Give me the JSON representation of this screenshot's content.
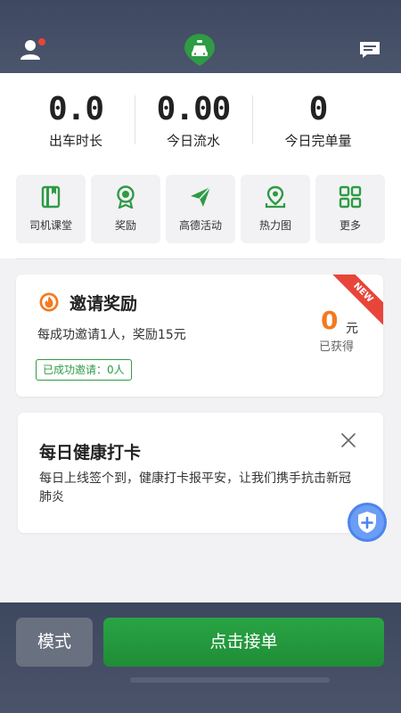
{
  "header": {
    "icons": [
      "user-icon",
      "taxi-logo-icon",
      "message-icon"
    ],
    "colors": {
      "notification_dot": "#e8453a",
      "logo_green": "#2e9b45"
    }
  },
  "stats": [
    {
      "value": "0.0",
      "label": "出车时长"
    },
    {
      "value": "0.00",
      "label": "今日流水"
    },
    {
      "value": "0",
      "label": "今日完单量"
    }
  ],
  "tiles": [
    {
      "label": "司机课堂",
      "icon": "book-icon"
    },
    {
      "label": "奖励",
      "icon": "medal-icon"
    },
    {
      "label": "高德活动",
      "icon": "paper-plane-icon"
    },
    {
      "label": "热力图",
      "icon": "map-pin-icon"
    },
    {
      "label": "更多",
      "icon": "grid-icon"
    }
  ],
  "invite": {
    "title": "邀请奖励",
    "ribbon": "NEW",
    "desc": "每成功邀请1人，奖励15元",
    "badge": "已成功邀请：0人",
    "amount": "0",
    "unit": "元",
    "earned_label": "已获得",
    "colors": {
      "amount": "#f47a1f",
      "badge": "#2e9b45",
      "ribbon": "#e8453a"
    }
  },
  "health": {
    "title": "每日健康打卡",
    "desc": "每日上线签个到，健康打卡报平安，让我们携手抗击新冠肺炎"
  },
  "bottom": {
    "mode_label": "模式",
    "take_order_label": "点击接单",
    "colors": {
      "take_order": "#24993e",
      "mode": "#69707f"
    }
  }
}
